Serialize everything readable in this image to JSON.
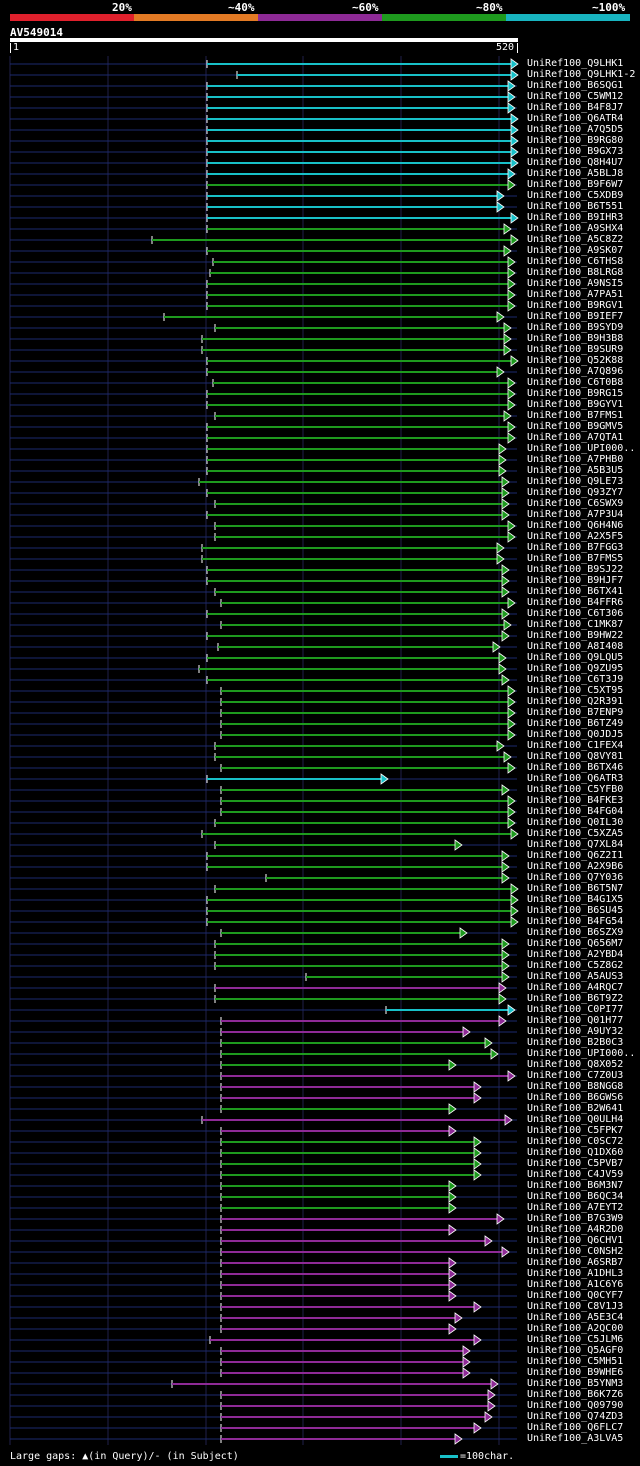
{
  "legend": {
    "labels": [
      "20%",
      "~40%",
      "~60%",
      "~80%",
      "~100%"
    ],
    "colors": [
      "#e0202c",
      "#e27a24",
      "#8e2a96",
      "#1e9a1e",
      "#18b4c0"
    ]
  },
  "query": {
    "name": "AV549014",
    "start": "1",
    "end": "520",
    "length": 520
  },
  "hits": [
    {
      "label": "UniRef100_Q9LHK1",
      "color": "#18c0c8",
      "start": 207,
      "end": 517
    },
    {
      "label": "UniRef100_Q9LHK1-2",
      "color": "#18c0c8",
      "start": 237,
      "end": 517
    },
    {
      "label": "UniRef100_B6SQG1",
      "color": "#18c0c8",
      "start": 207,
      "end": 514
    },
    {
      "label": "UniRef100_C5WM12",
      "color": "#18c0c8",
      "start": 207,
      "end": 514
    },
    {
      "label": "UniRef100_B4F8J7",
      "color": "#18c0c8",
      "start": 207,
      "end": 514
    },
    {
      "label": "UniRef100_Q6ATR4",
      "color": "#18c0c8",
      "start": 207,
      "end": 517
    },
    {
      "label": "UniRef100_A7Q5D5",
      "color": "#18c0c8",
      "start": 207,
      "end": 517
    },
    {
      "label": "UniRef100_B9RG80",
      "color": "#18c0c8",
      "start": 207,
      "end": 517
    },
    {
      "label": "UniRef100_B9GX73",
      "color": "#18c0c8",
      "start": 207,
      "end": 517
    },
    {
      "label": "UniRef100_Q8H4U7",
      "color": "#18c0c8",
      "start": 207,
      "end": 517
    },
    {
      "label": "UniRef100_A5BLJ8",
      "color": "#18c0c8",
      "start": 207,
      "end": 514
    },
    {
      "label": "UniRef100_B9F6W7",
      "color": "#1e9a1e",
      "start": 207,
      "end": 514
    },
    {
      "label": "UniRef100_C5XDB9",
      "color": "#18c0c8",
      "start": 207,
      "end": 503
    },
    {
      "label": "UniRef100_B6T551",
      "color": "#18c0c8",
      "start": 207,
      "end": 503
    },
    {
      "label": "UniRef100_B9IHR3",
      "color": "#18c0c8",
      "start": 207,
      "end": 517
    },
    {
      "label": "UniRef100_A9SHX4",
      "color": "#1e9a1e",
      "start": 207,
      "end": 510
    },
    {
      "label": "UniRef100_A5C8Z2",
      "color": "#1e9a1e",
      "start": 152,
      "end": 517
    },
    {
      "label": "UniRef100_A9SK07",
      "color": "#1e9a1e",
      "start": 207,
      "end": 510
    },
    {
      "label": "UniRef100_C6THS8",
      "color": "#1e9a1e",
      "start": 213,
      "end": 514
    },
    {
      "label": "UniRef100_B8LRG8",
      "color": "#1e9a1e",
      "start": 210,
      "end": 514
    },
    {
      "label": "UniRef100_A9NSI5",
      "color": "#1e9a1e",
      "start": 207,
      "end": 514
    },
    {
      "label": "UniRef100_A7PA51",
      "color": "#1e9a1e",
      "start": 207,
      "end": 514
    },
    {
      "label": "UniRef100_B9RGV1",
      "color": "#1e9a1e",
      "start": 207,
      "end": 514
    },
    {
      "label": "UniRef100_B9IEF7",
      "color": "#1e9a1e",
      "start": 164,
      "end": 503
    },
    {
      "label": "UniRef100_B9SYD9",
      "color": "#1e9a1e",
      "start": 215,
      "end": 510
    },
    {
      "label": "UniRef100_B9H3B8",
      "color": "#1e9a1e",
      "start": 202,
      "end": 510
    },
    {
      "label": "UniRef100_B9SUR9",
      "color": "#1e9a1e",
      "start": 202,
      "end": 510
    },
    {
      "label": "UniRef100_Q52K88",
      "color": "#1e9a1e",
      "start": 207,
      "end": 517
    },
    {
      "label": "UniRef100_A7Q896",
      "color": "#1e9a1e",
      "start": 207,
      "end": 503
    },
    {
      "label": "UniRef100_C6T0B8",
      "color": "#1e9a1e",
      "start": 213,
      "end": 514
    },
    {
      "label": "UniRef100_B9RG15",
      "color": "#1e9a1e",
      "start": 207,
      "end": 514
    },
    {
      "label": "UniRef100_B9GYV1",
      "color": "#1e9a1e",
      "start": 207,
      "end": 514
    },
    {
      "label": "UniRef100_B7FMS1",
      "color": "#1e9a1e",
      "start": 215,
      "end": 510
    },
    {
      "label": "UniRef100_B9GMV5",
      "color": "#1e9a1e",
      "start": 207,
      "end": 514
    },
    {
      "label": "UniRef100_A7QTA1",
      "color": "#1e9a1e",
      "start": 207,
      "end": 514
    },
    {
      "label": "UniRef100_UPI000..",
      "color": "#1e9a1e",
      "start": 207,
      "end": 505
    },
    {
      "label": "UniRef100_A7PHB0",
      "color": "#1e9a1e",
      "start": 207,
      "end": 505
    },
    {
      "label": "UniRef100_A5B3U5",
      "color": "#1e9a1e",
      "start": 207,
      "end": 505
    },
    {
      "label": "UniRef100_Q9LE73",
      "color": "#1e9a1e",
      "start": 199,
      "end": 508
    },
    {
      "label": "UniRef100_Q93ZY7",
      "color": "#1e9a1e",
      "start": 207,
      "end": 508
    },
    {
      "label": "UniRef100_C6SWX9",
      "color": "#1e9a1e",
      "start": 215,
      "end": 508
    },
    {
      "label": "UniRef100_A7P3U4",
      "color": "#1e9a1e",
      "start": 207,
      "end": 508
    },
    {
      "label": "UniRef100_Q6H4N6",
      "color": "#1e9a1e",
      "start": 215,
      "end": 514
    },
    {
      "label": "UniRef100_A2X5F5",
      "color": "#1e9a1e",
      "start": 215,
      "end": 514
    },
    {
      "label": "UniRef100_B7FGG3",
      "color": "#1e9a1e",
      "start": 202,
      "end": 503
    },
    {
      "label": "UniRef100_B7FMS5",
      "color": "#1e9a1e",
      "start": 202,
      "end": 503
    },
    {
      "label": "UniRef100_B9SJ22",
      "color": "#1e9a1e",
      "start": 207,
      "end": 508
    },
    {
      "label": "UniRef100_B9HJF7",
      "color": "#1e9a1e",
      "start": 207,
      "end": 508
    },
    {
      "label": "UniRef100_B6TX41",
      "color": "#1e9a1e",
      "start": 215,
      "end": 508
    },
    {
      "label": "UniRef100_B4FFR6",
      "color": "#1e9a1e",
      "start": 221,
      "end": 514
    },
    {
      "label": "UniRef100_C6T306",
      "color": "#1e9a1e",
      "start": 207,
      "end": 508
    },
    {
      "label": "UniRef100_C1MK87",
      "color": "#1e9a1e",
      "start": 221,
      "end": 510
    },
    {
      "label": "UniRef100_B9HW22",
      "color": "#1e9a1e",
      "start": 207,
      "end": 508
    },
    {
      "label": "UniRef100_A8I408",
      "color": "#1e9a1e",
      "start": 218,
      "end": 499
    },
    {
      "label": "UniRef100_Q9LQU5",
      "color": "#1e9a1e",
      "start": 207,
      "end": 505
    },
    {
      "label": "UniRef100_Q9ZU95",
      "color": "#1e9a1e",
      "start": 199,
      "end": 505
    },
    {
      "label": "UniRef100_C6T3J9",
      "color": "#1e9a1e",
      "start": 207,
      "end": 508
    },
    {
      "label": "UniRef100_C5XT95",
      "color": "#1e9a1e",
      "start": 221,
      "end": 514
    },
    {
      "label": "UniRef100_Q2R391",
      "color": "#1e9a1e",
      "start": 221,
      "end": 514
    },
    {
      "label": "UniRef100_B7ENP9",
      "color": "#1e9a1e",
      "start": 221,
      "end": 514
    },
    {
      "label": "UniRef100_B6TZ49",
      "color": "#1e9a1e",
      "start": 221,
      "end": 514
    },
    {
      "label": "UniRef100_Q0JDJ5",
      "color": "#1e9a1e",
      "start": 221,
      "end": 514
    },
    {
      "label": "UniRef100_C1FEX4",
      "color": "#1e9a1e",
      "start": 215,
      "end": 503
    },
    {
      "label": "UniRef100_Q8VY81",
      "color": "#1e9a1e",
      "start": 215,
      "end": 510
    },
    {
      "label": "UniRef100_B6TX46",
      "color": "#1e9a1e",
      "start": 221,
      "end": 514
    },
    {
      "label": "UniRef100_Q6ATR3",
      "color": "#18c0c8",
      "start": 207,
      "end": 387
    },
    {
      "label": "UniRef100_C5YFB0",
      "color": "#1e9a1e",
      "start": 221,
      "end": 508
    },
    {
      "label": "UniRef100_B4FKE3",
      "color": "#1e9a1e",
      "start": 221,
      "end": 514
    },
    {
      "label": "UniRef100_B4FG04",
      "color": "#1e9a1e",
      "start": 221,
      "end": 514
    },
    {
      "label": "UniRef100_Q0IL30",
      "color": "#1e9a1e",
      "start": 215,
      "end": 514
    },
    {
      "label": "UniRef100_C5XZA5",
      "color": "#1e9a1e",
      "start": 202,
      "end": 517
    },
    {
      "label": "UniRef100_Q7XL84",
      "color": "#1e9a1e",
      "start": 215,
      "end": 461
    },
    {
      "label": "UniRef100_Q6Z2I1",
      "color": "#1e9a1e",
      "start": 207,
      "end": 508
    },
    {
      "label": "UniRef100_A2X9B6",
      "color": "#1e9a1e",
      "start": 207,
      "end": 508
    },
    {
      "label": "UniRef100_Q7Y036",
      "color": "#1e9a1e",
      "start": 266,
      "end": 508
    },
    {
      "label": "UniRef100_B6T5N7",
      "color": "#1e9a1e",
      "start": 215,
      "end": 517
    },
    {
      "label": "UniRef100_B4G1X5",
      "color": "#1e9a1e",
      "start": 207,
      "end": 517
    },
    {
      "label": "UniRef100_B6SU45",
      "color": "#1e9a1e",
      "start": 207,
      "end": 517
    },
    {
      "label": "UniRef100_B4FG54",
      "color": "#1e9a1e",
      "start": 207,
      "end": 517
    },
    {
      "label": "UniRef100_B6SZX9",
      "color": "#1e9a1e",
      "start": 221,
      "end": 466
    },
    {
      "label": "UniRef100_Q656M7",
      "color": "#1e9a1e",
      "start": 215,
      "end": 508
    },
    {
      "label": "UniRef100_A2YBD4",
      "color": "#1e9a1e",
      "start": 215,
      "end": 508
    },
    {
      "label": "UniRef100_C5Z8G2",
      "color": "#1e9a1e",
      "start": 215,
      "end": 508
    },
    {
      "label": "UniRef100_A5AUS3",
      "color": "#1e9a1e",
      "start": 306,
      "end": 508
    },
    {
      "label": "UniRef100_A4RQC7",
      "color": "#8e2a96",
      "start": 215,
      "end": 505
    },
    {
      "label": "UniRef100_B6T9Z2",
      "color": "#1e9a1e",
      "start": 215,
      "end": 505
    },
    {
      "label": "UniRef100_C0PI77",
      "color": "#18c0c8",
      "start": 386,
      "end": 514
    },
    {
      "label": "UniRef100_Q01H77",
      "color": "#8e2a96",
      "start": 221,
      "end": 505
    },
    {
      "label": "UniRef100_A9UY32",
      "color": "#8e2a96",
      "start": 221,
      "end": 469
    },
    {
      "label": "UniRef100_B2B0C3",
      "color": "#1e9a1e",
      "start": 221,
      "end": 491
    },
    {
      "label": "UniRef100_UPI000..",
      "color": "#1e9a1e",
      "start": 221,
      "end": 497
    },
    {
      "label": "UniRef100_Q8X052",
      "color": "#1e9a1e",
      "start": 221,
      "end": 455
    },
    {
      "label": "UniRef100_C7Z0U3",
      "color": "#8e2a96",
      "start": 221,
      "end": 514
    },
    {
      "label": "UniRef100_B8NGG8",
      "color": "#8e2a96",
      "start": 221,
      "end": 480
    },
    {
      "label": "UniRef100_B6GWS6",
      "color": "#8e2a96",
      "start": 221,
      "end": 480
    },
    {
      "label": "UniRef100_B2W641",
      "color": "#1e9a1e",
      "start": 221,
      "end": 455
    },
    {
      "label": "UniRef100_Q0ULH4",
      "color": "#8e2a96",
      "start": 202,
      "end": 511
    },
    {
      "label": "UniRef100_C5FPK7",
      "color": "#8e2a96",
      "start": 221,
      "end": 455
    },
    {
      "label": "UniRef100_C0SC72",
      "color": "#1e9a1e",
      "start": 221,
      "end": 480
    },
    {
      "label": "UniRef100_Q1DX60",
      "color": "#1e9a1e",
      "start": 221,
      "end": 480
    },
    {
      "label": "UniRef100_C5PVB7",
      "color": "#1e9a1e",
      "start": 221,
      "end": 480
    },
    {
      "label": "UniRef100_C4JV59",
      "color": "#1e9a1e",
      "start": 221,
      "end": 480
    },
    {
      "label": "UniRef100_B6M3N7",
      "color": "#1e9a1e",
      "start": 221,
      "end": 455
    },
    {
      "label": "UniRef100_B6QC34",
      "color": "#1e9a1e",
      "start": 221,
      "end": 455
    },
    {
      "label": "UniRef100_A7EYT2",
      "color": "#1e9a1e",
      "start": 221,
      "end": 455
    },
    {
      "label": "UniRef100_B7G3W9",
      "color": "#8e2a96",
      "start": 221,
      "end": 503
    },
    {
      "label": "UniRef100_A4R2D0",
      "color": "#8e2a96",
      "start": 221,
      "end": 455
    },
    {
      "label": "UniRef100_Q6CHV1",
      "color": "#8e2a96",
      "start": 221,
      "end": 491
    },
    {
      "label": "UniRef100_C0NSH2",
      "color": "#8e2a96",
      "start": 221,
      "end": 508
    },
    {
      "label": "UniRef100_A6SRB7",
      "color": "#8e2a96",
      "start": 221,
      "end": 455
    },
    {
      "label": "UniRef100_A1DHL3",
      "color": "#8e2a96",
      "start": 221,
      "end": 455
    },
    {
      "label": "UniRef100_A1C6Y6",
      "color": "#8e2a96",
      "start": 221,
      "end": 455
    },
    {
      "label": "UniRef100_Q0CYF7",
      "color": "#8e2a96",
      "start": 221,
      "end": 455
    },
    {
      "label": "UniRef100_C8V1J3",
      "color": "#8e2a96",
      "start": 221,
      "end": 480
    },
    {
      "label": "UniRef100_A5E3C4",
      "color": "#8e2a96",
      "start": 221,
      "end": 461
    },
    {
      "label": "UniRef100_A2QC00",
      "color": "#8e2a96",
      "start": 221,
      "end": 455
    },
    {
      "label": "UniRef100_C5JLM6",
      "color": "#8e2a96",
      "start": 210,
      "end": 480
    },
    {
      "label": "UniRef100_Q5AGF0",
      "color": "#8e2a96",
      "start": 221,
      "end": 469
    },
    {
      "label": "UniRef100_C5MH51",
      "color": "#8e2a96",
      "start": 221,
      "end": 469
    },
    {
      "label": "UniRef100_B9WHE6",
      "color": "#8e2a96",
      "start": 221,
      "end": 469
    },
    {
      "label": "UniRef100_B5YNM3",
      "color": "#8e2a96",
      "start": 172,
      "end": 497
    },
    {
      "label": "UniRef100_B6K7Z6",
      "color": "#8e2a96",
      "start": 221,
      "end": 494
    },
    {
      "label": "UniRef100_Q09790",
      "color": "#8e2a96",
      "start": 221,
      "end": 494
    },
    {
      "label": "UniRef100_Q74ZD3",
      "color": "#8e2a96",
      "start": 221,
      "end": 491
    },
    {
      "label": "UniRef100_Q6FLC7",
      "color": "#8e2a96",
      "start": 221,
      "end": 480
    },
    {
      "label": "UniRef100_A3LVA5",
      "color": "#8e2a96",
      "start": 221,
      "end": 461
    }
  ],
  "footer": {
    "gaps_label": "Large gaps: ",
    "query_gap": "(in Query)/",
    "subject_gap": "- (in Subject)",
    "scale_label": "=100char."
  },
  "scale_color": "#18c0c8"
}
